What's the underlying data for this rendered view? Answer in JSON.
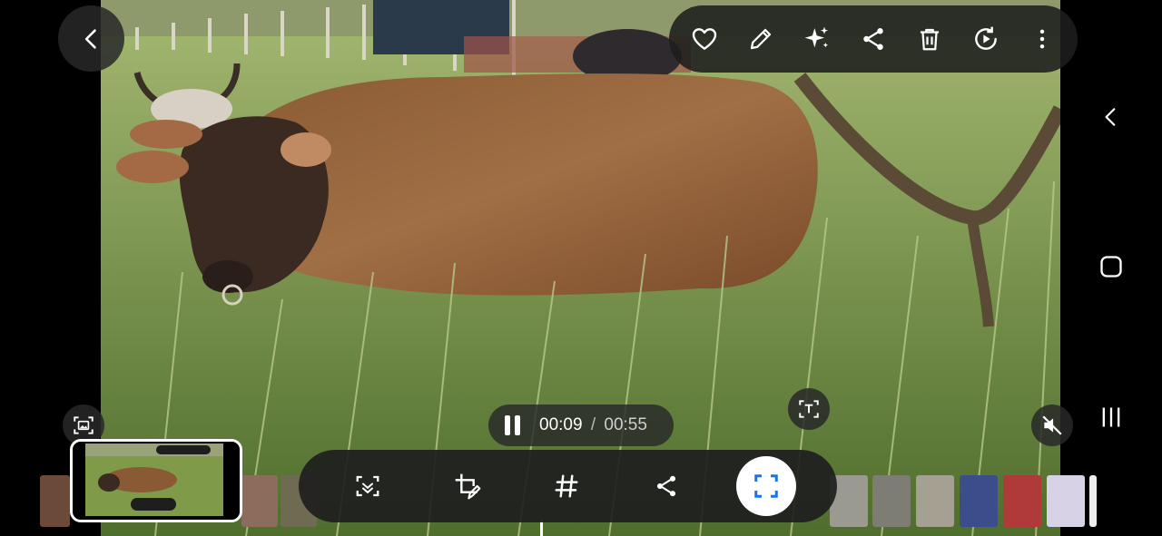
{
  "playback": {
    "current_time": "00:09",
    "separator": "/",
    "total_time": "00:55",
    "state": "playing"
  },
  "icons": {
    "back": "chevron-left-icon",
    "top_toolbar": [
      "heart-icon",
      "pencil-icon",
      "sparkle-icon",
      "share-icon",
      "trash-icon",
      "replay-icon",
      "more-vertical-icon"
    ],
    "capture": "screen-capture-icon",
    "text_recognition": "text-scan-icon",
    "mute": "speaker-muted-icon",
    "bottom_actions": [
      "scan-frame-icon",
      "edit-crop-icon",
      "hashtag-icon",
      "share-icon",
      "focus-scan-icon"
    ],
    "nav": [
      "nav-back-icon",
      "nav-home-icon",
      "nav-recents-icon"
    ]
  },
  "colors": {
    "toolbar_bg": "#1e1e1e",
    "accent_blue": "#1a73e8",
    "icon": "#ffffff"
  },
  "filmstrip": {
    "current_index": 1
  }
}
